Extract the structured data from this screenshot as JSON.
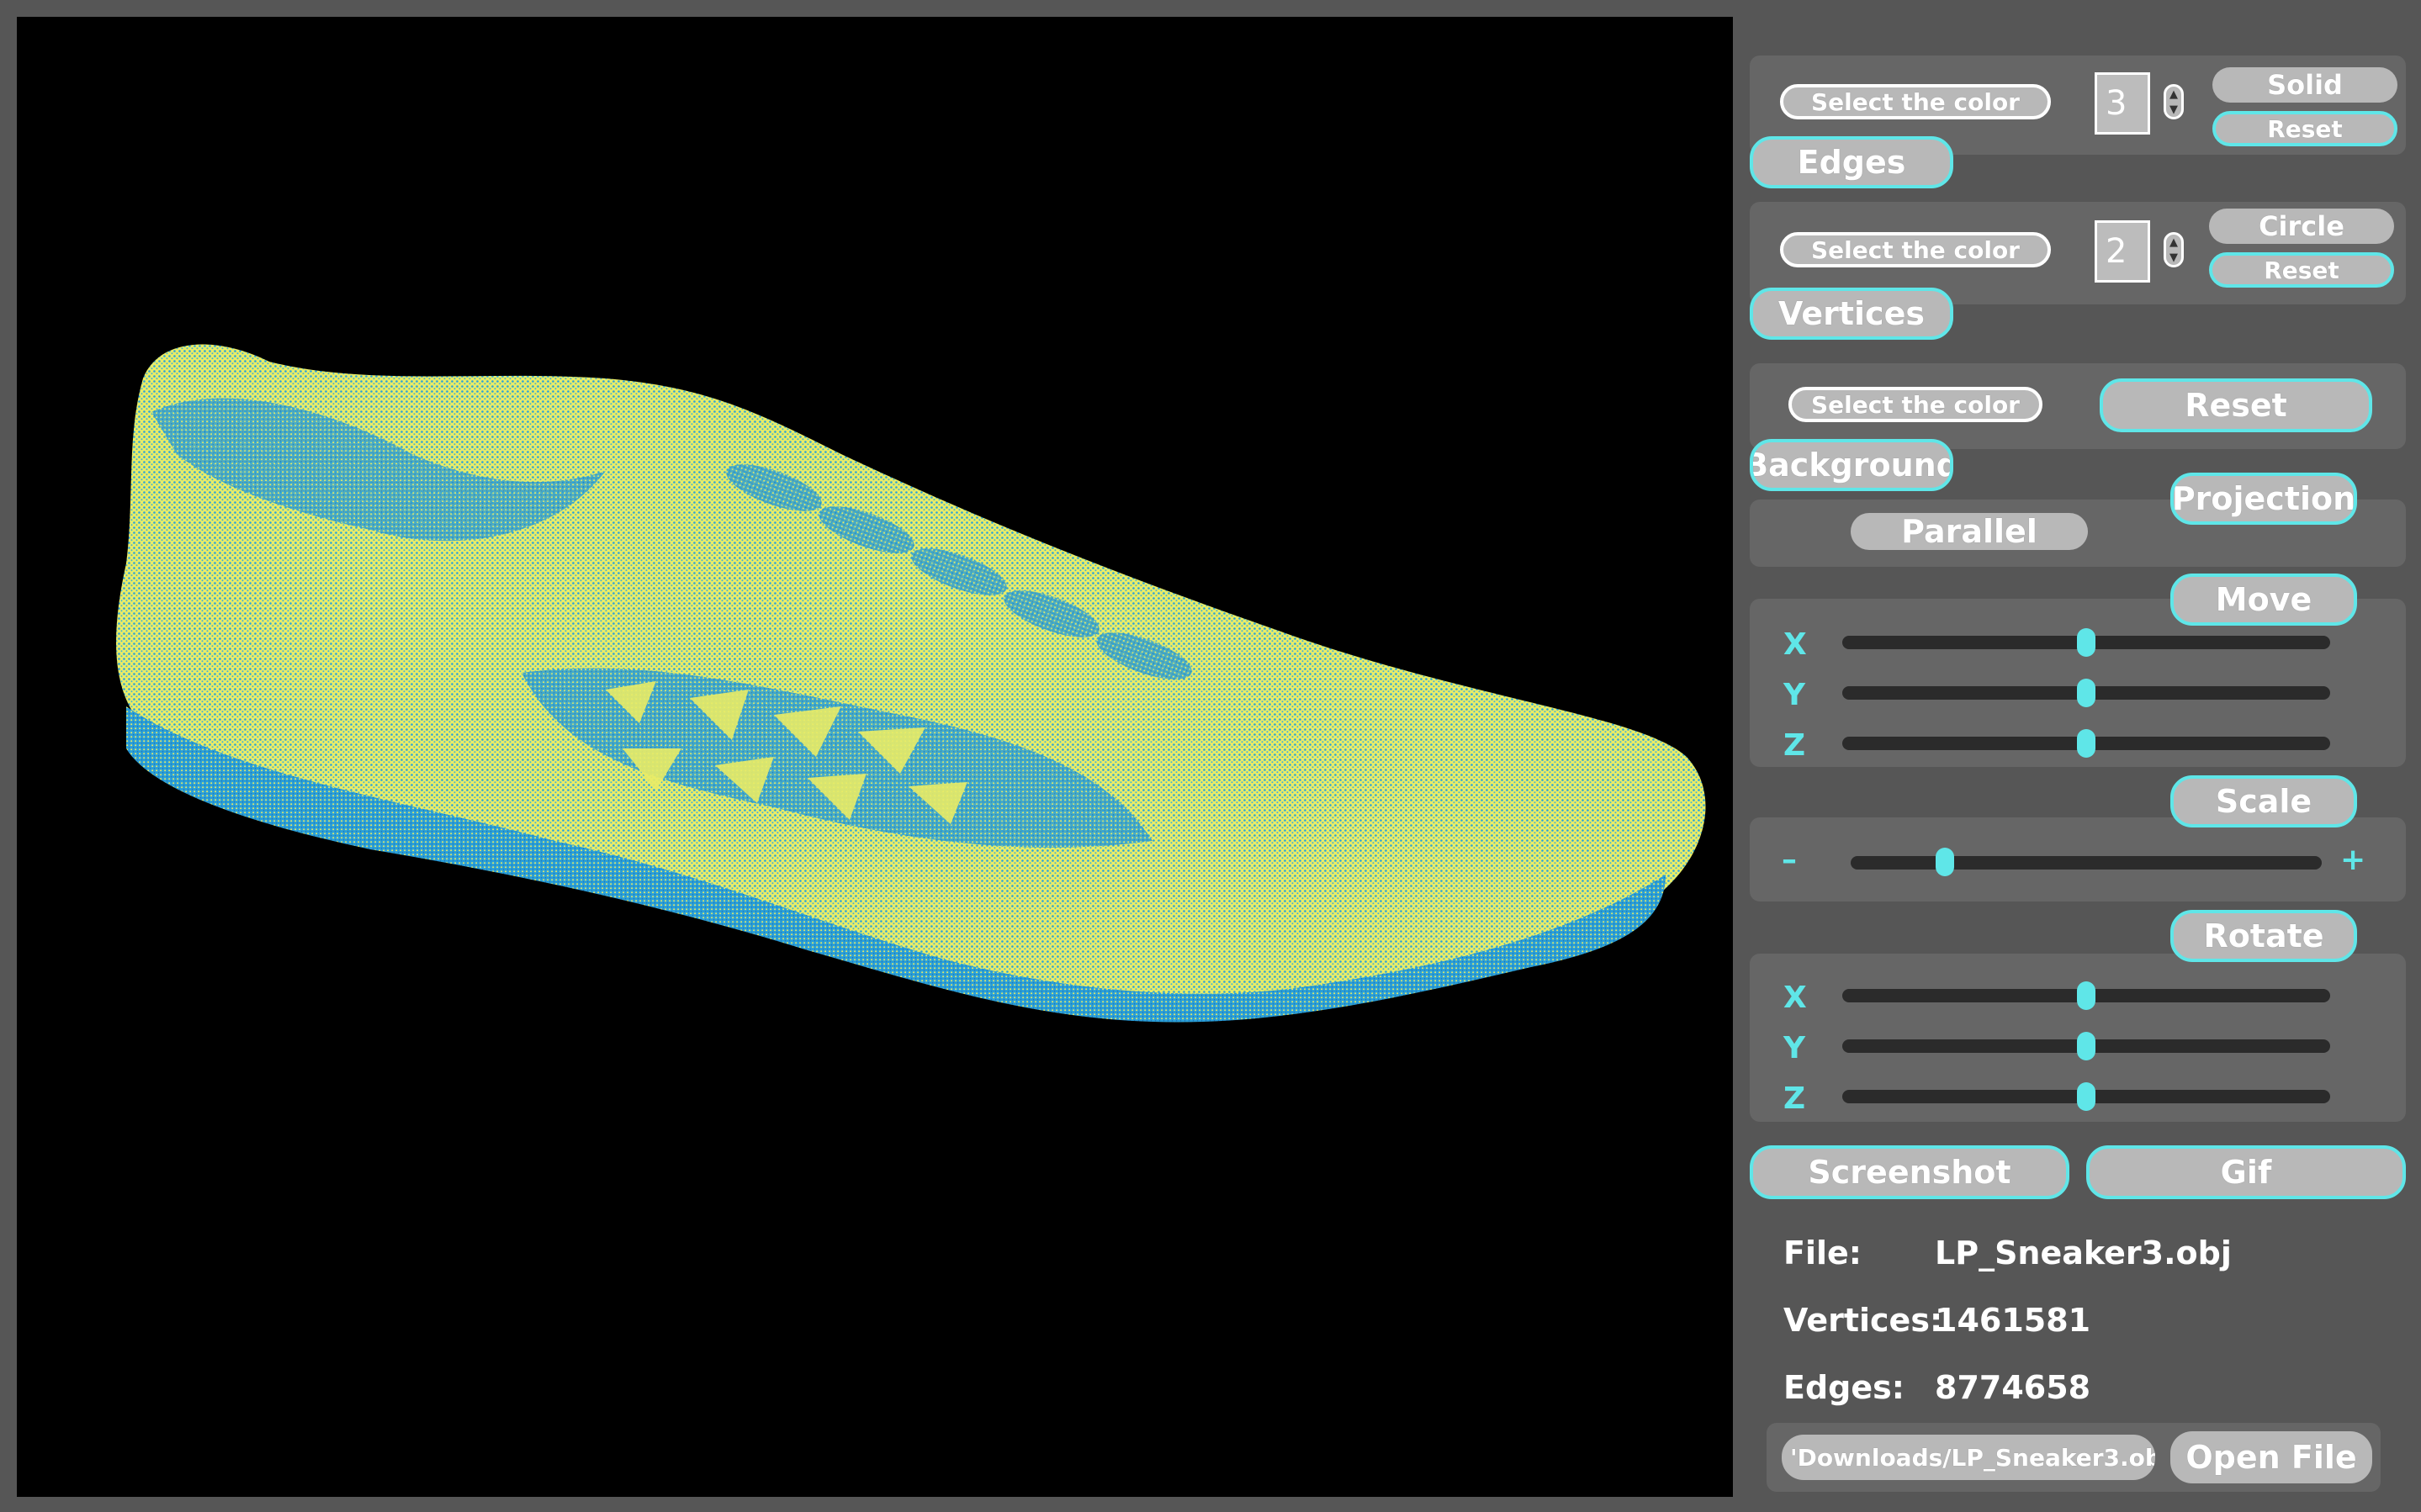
{
  "edges": {
    "color_button": "Select the color",
    "thickness": "3",
    "mode": "Solid",
    "reset": "Reset",
    "section": "Edges"
  },
  "vertices": {
    "color_button": "Select the color",
    "thickness": "2",
    "mode": "Circle",
    "reset": "Reset",
    "section": "Vertices"
  },
  "background": {
    "color_button": "Select the color",
    "reset": "Reset",
    "section": "Background"
  },
  "projection": {
    "section": "Projection",
    "mode": "Parallel"
  },
  "move": {
    "section": "Move",
    "axes": [
      {
        "label": "X",
        "value": 0.5
      },
      {
        "label": "Y",
        "value": 0.5
      },
      {
        "label": "Z",
        "value": 0.5
      }
    ]
  },
  "scale": {
    "section": "Scale",
    "minus": "–",
    "plus": "+",
    "value": 0.2
  },
  "rotate": {
    "section": "Rotate",
    "axes": [
      {
        "label": "X",
        "value": 0.5
      },
      {
        "label": "Y",
        "value": 0.5
      },
      {
        "label": "Z",
        "value": 0.5
      }
    ]
  },
  "actions": {
    "screenshot": "Screenshot",
    "gif": "Gif"
  },
  "info": {
    "file_label": "File:",
    "file_value": "LP_Sneaker3.obj",
    "vertices_label": "Vertices:",
    "vertices_value": "1461581",
    "edges_label": "Edges:",
    "edges_value": "8774658"
  },
  "file": {
    "path": "'Downloads/LP_Sneaker3.obj",
    "open": "Open File"
  },
  "colors": {
    "accent": "#5fe6e8",
    "model_primary": "#f4f36a",
    "model_secondary": "#2a9fd8",
    "viewport_bg": "#000000"
  }
}
